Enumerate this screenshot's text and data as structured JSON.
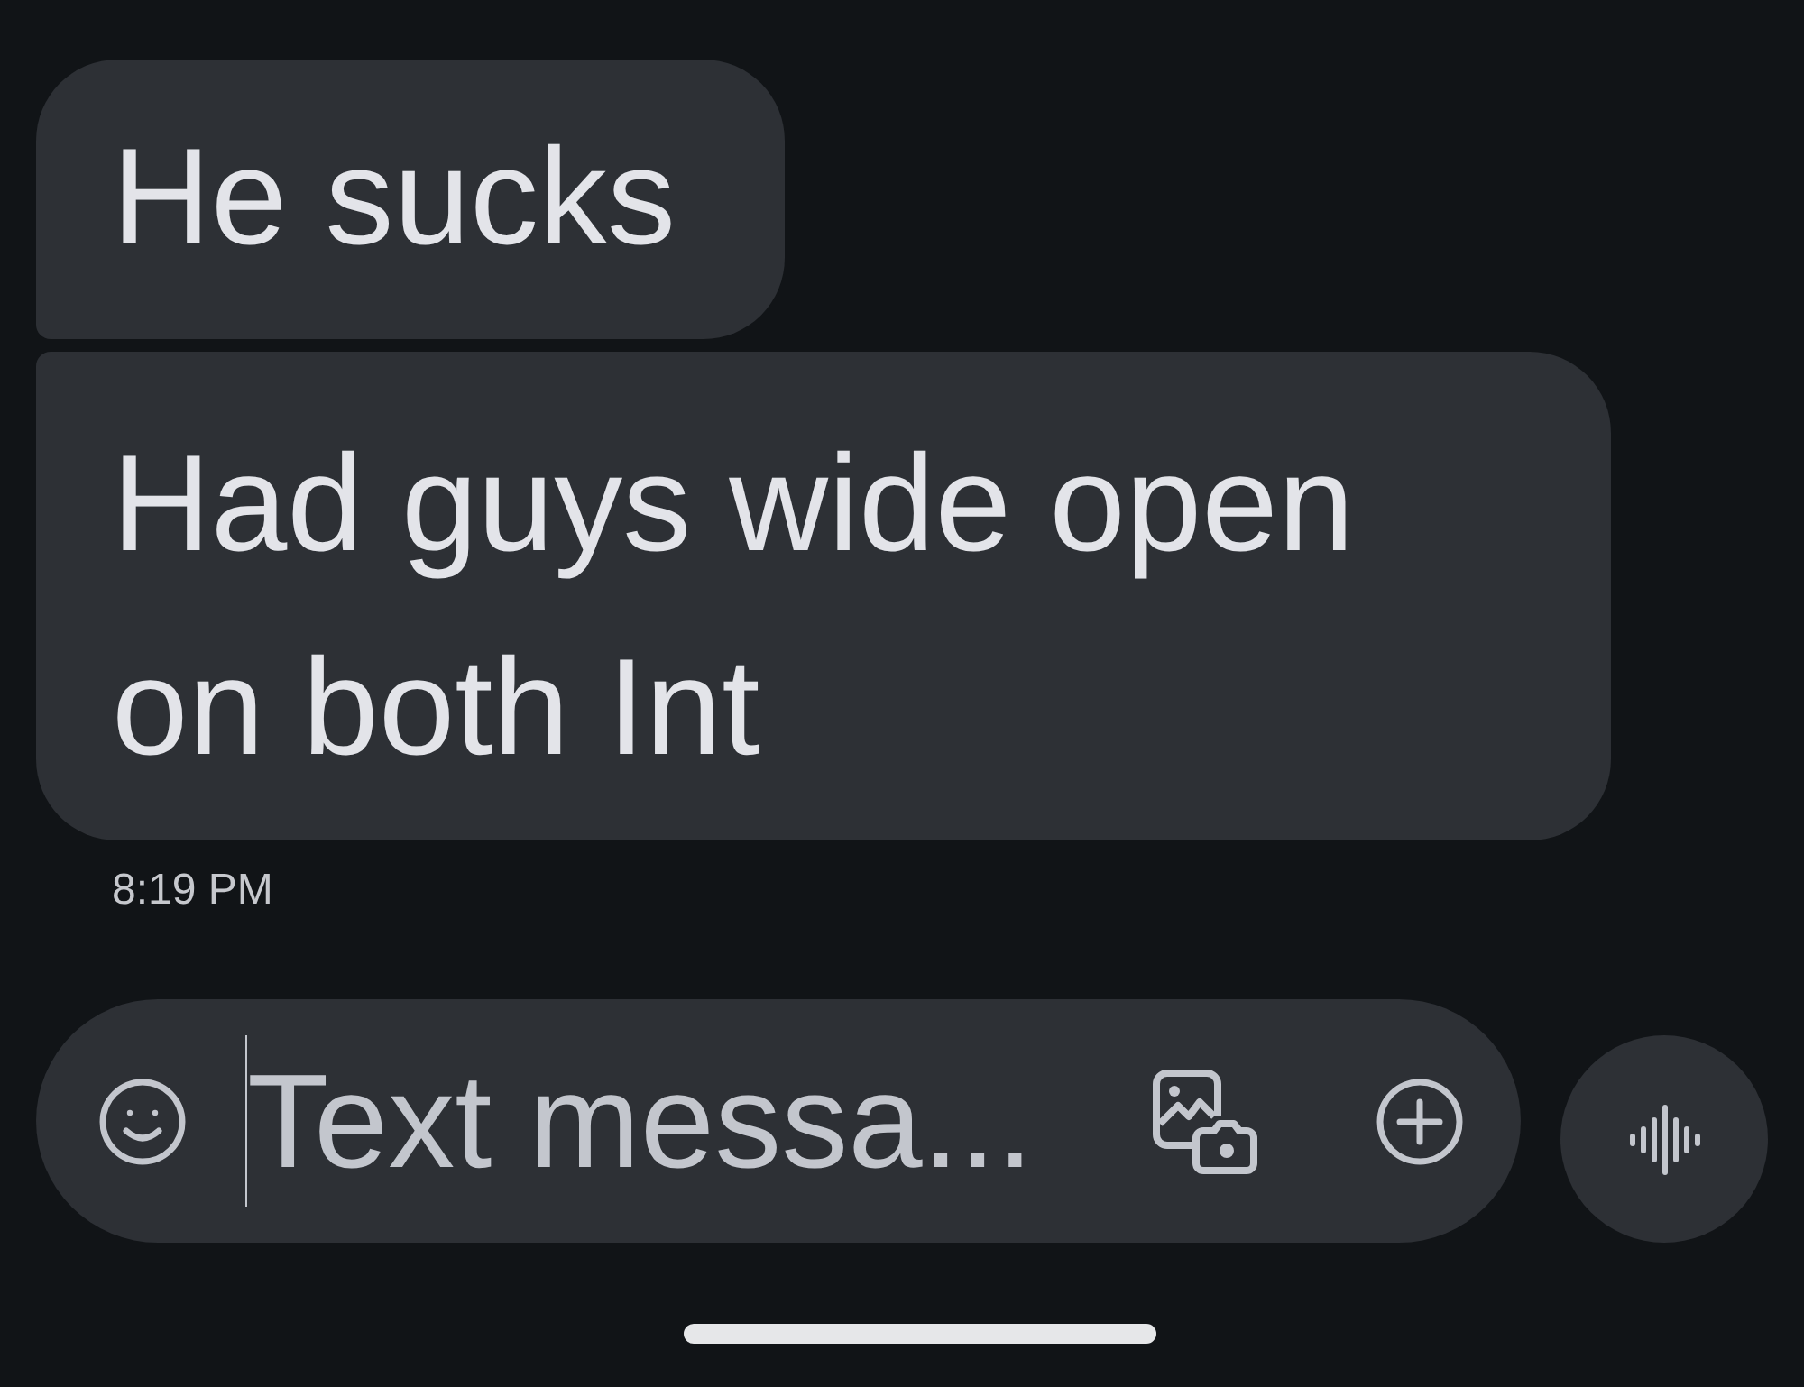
{
  "messages": [
    {
      "text": "He sucks"
    },
    {
      "text": "Had guys wide open on both Int"
    }
  ],
  "timestamp": "8:19 PM",
  "composer": {
    "placeholder": "Text messa..."
  }
}
